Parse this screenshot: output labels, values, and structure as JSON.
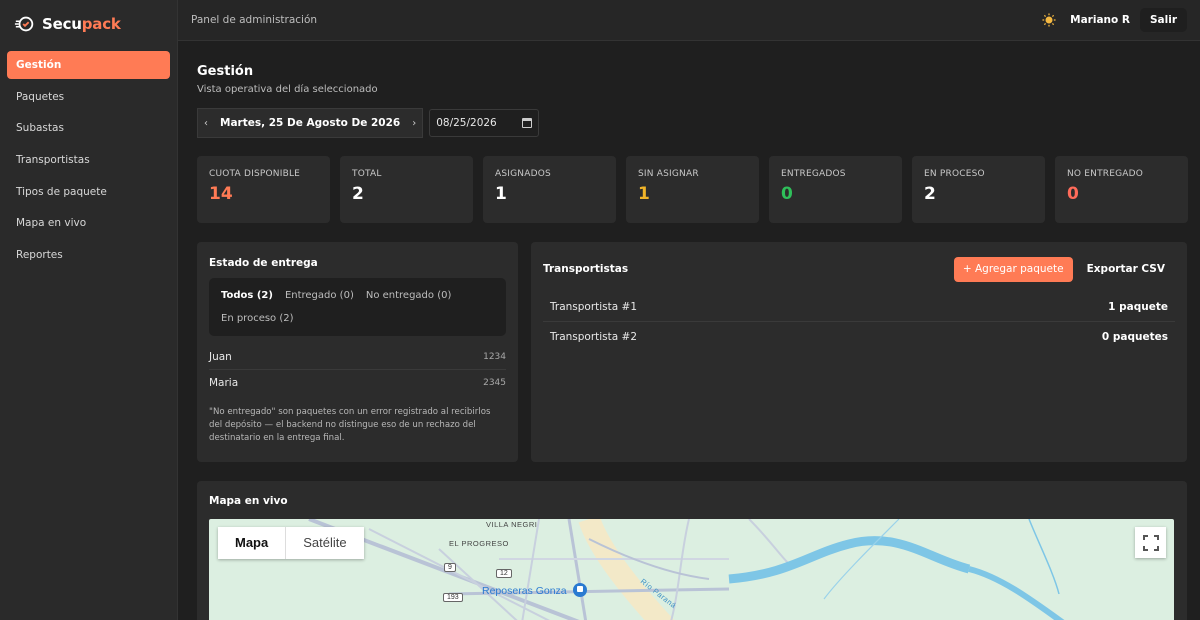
{
  "brand": {
    "name_part1": "Secu",
    "name_part2": "pack"
  },
  "sidebar": {
    "items": [
      {
        "label": "Gestión",
        "active": true
      },
      {
        "label": "Paquetes"
      },
      {
        "label": "Subastas"
      },
      {
        "label": "Transportistas"
      },
      {
        "label": "Tipos de paquete"
      },
      {
        "label": "Mapa en vivo"
      },
      {
        "label": "Reportes"
      }
    ]
  },
  "topbar": {
    "title": "Panel de administración",
    "user": "Mariano R",
    "logout_label": "Salir",
    "theme_icon": "sun-icon"
  },
  "page": {
    "title": "Gestión",
    "subtitle": "Vista operativa del día seleccionado"
  },
  "datebar": {
    "prev": "‹",
    "next": "›",
    "date_label": "Martes, 25 De Agosto De 2026",
    "date_value": "08/25/2026"
  },
  "stats": [
    {
      "label": "CUOTA DISPONIBLE",
      "value": "14",
      "color": "#ff7b55"
    },
    {
      "label": "TOTAL",
      "value": "2",
      "color": "#ffffff"
    },
    {
      "label": "ASIGNADOS",
      "value": "1",
      "color": "#ffffff"
    },
    {
      "label": "SIN ASIGNAR",
      "value": "1",
      "color": "#f0b429"
    },
    {
      "label": "ENTREGADOS",
      "value": "0",
      "color": "#2fbf5a"
    },
    {
      "label": "EN PROCESO",
      "value": "2",
      "color": "#ffffff"
    },
    {
      "label": "NO ENTREGADO",
      "value": "0",
      "color": "#ff6b5a"
    }
  ],
  "estado": {
    "title": "Estado de entrega",
    "filters": [
      {
        "label": "Todos (2)",
        "active": true
      },
      {
        "label": "Entregado (0)"
      },
      {
        "label": "No entregado (0)"
      },
      {
        "label": "En proceso (2)"
      }
    ],
    "rows": [
      {
        "name": "Juan",
        "code": "1234"
      },
      {
        "name": "Maria",
        "code": "2345"
      }
    ],
    "note": "\"No entregado\" son paquetes con un error registrado al recibirlos del depósito — el backend no distingue eso de un rechazo del destinatario en la entrega final."
  },
  "transportistas": {
    "title": "Transportistas",
    "add_label": "+ Agregar paquete",
    "export_label": "Exportar CSV",
    "rows": [
      {
        "name": "Transportista #1",
        "count": "1 paquete"
      },
      {
        "name": "Transportista #2",
        "count": "0 paquetes"
      }
    ]
  },
  "map": {
    "title": "Mapa en vivo",
    "tab_map": "Mapa",
    "tab_satellite": "Satélite",
    "labels": {
      "villa_negri": "VILLA NEGRI",
      "el_progreso": "EL PROGRESO",
      "place": "Reposeras Gonza",
      "river": "Río Paraná",
      "r9": "9",
      "r12": "12",
      "r193": "193"
    }
  }
}
